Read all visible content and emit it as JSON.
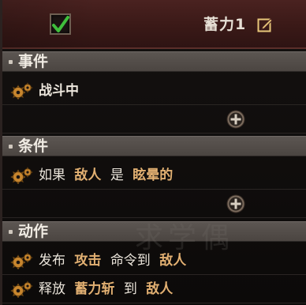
{
  "header": {
    "title": "蓄力1",
    "checked": true
  },
  "sections": {
    "events": {
      "title": "事件",
      "rows": [
        {
          "text": "战斗中"
        }
      ]
    },
    "conditions": {
      "title": "条件",
      "rows": [
        {
          "t1": "如果",
          "t2": "敌人",
          "t3": "是",
          "t4": "眩晕的"
        }
      ]
    },
    "actions": {
      "title": "动作",
      "rows": [
        {
          "t1": "发布",
          "t2": "攻击",
          "t3": "命令到",
          "t4": "敌人"
        },
        {
          "t1": "释放",
          "t2": "蓄力斩",
          "t3": "到",
          "t4": "敌人"
        }
      ]
    }
  },
  "watermark": "求学偶",
  "icons": {
    "checkbox": "checkmark-icon",
    "edit": "edit-icon",
    "gear": "gear-icon",
    "add": "add-icon"
  },
  "colors": {
    "header_bg": "#3a1917",
    "highlight_text": "#e2b072",
    "check_green": "#3fbf3c",
    "section_bg": "#524c48"
  }
}
